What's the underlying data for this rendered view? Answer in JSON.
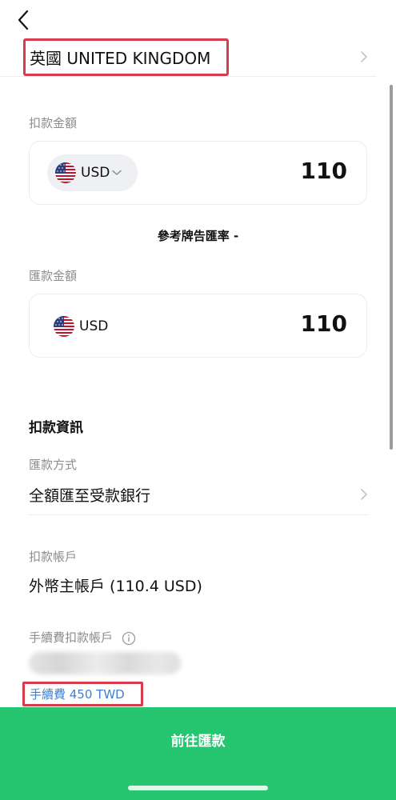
{
  "header": {
    "back_icon": "chevron-left-icon",
    "country": "英國 UNITED KINGDOM"
  },
  "debit_amount": {
    "label": "扣款金額",
    "currency": "USD",
    "currency_icon": "us-flag-icon",
    "amount": "110"
  },
  "rate": {
    "text": "參考牌告匯率 -"
  },
  "remit_amount": {
    "label": "匯款金額",
    "currency": "USD",
    "currency_icon": "us-flag-icon",
    "amount": "110"
  },
  "debit_info": {
    "title": "扣款資訊",
    "method_label": "匯款方式",
    "method_value": "全額匯至受款銀行",
    "account_label": "扣款帳戶",
    "account_value": "外幣主帳戶 (110.4 USD)",
    "fee_account_label": "手續費扣款帳戶",
    "fee_text": "手續費 450 TWD"
  },
  "footer": {
    "submit_label": "前往匯款"
  },
  "colors": {
    "accent_green": "#26c56f",
    "highlight_red": "#d73c4e",
    "link_blue": "#3f7fcf"
  }
}
